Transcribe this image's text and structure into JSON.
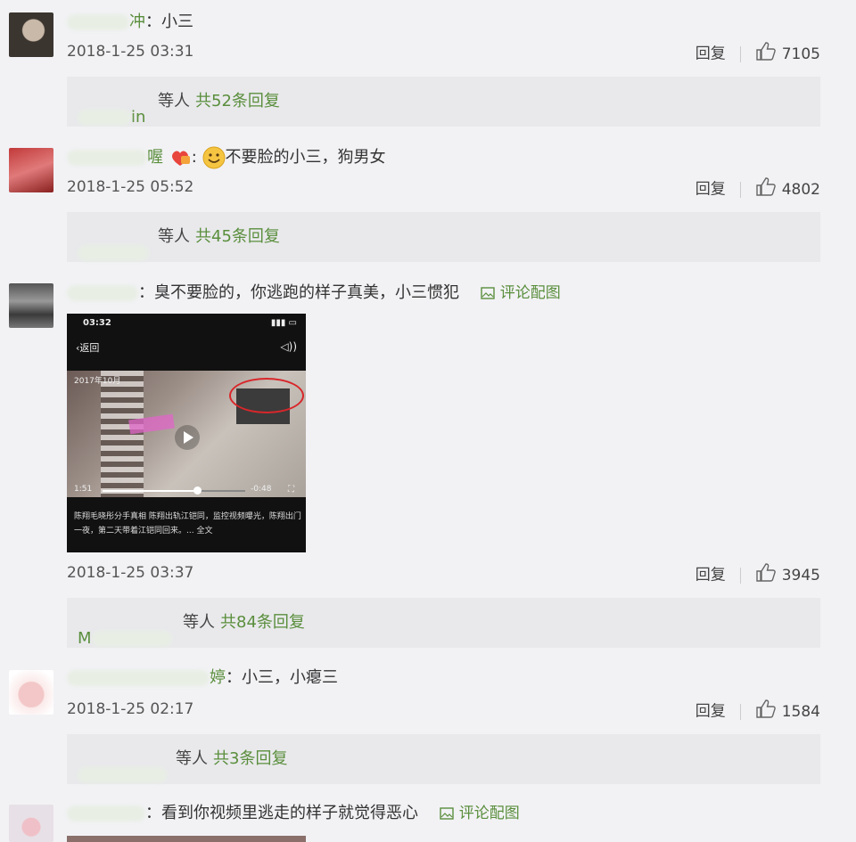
{
  "comments": [
    {
      "username_visible": "冲",
      "text": "小三",
      "time": "2018-1-25 03:31",
      "reply_label": "回复",
      "likes": "7105",
      "reply_summary": {
        "names_visible": "in",
        "suffix": "等人",
        "total": "共52条回复"
      }
    },
    {
      "username_visible": "喔",
      "text": "不要脸的小三，狗男女",
      "time": "2018-1-25 05:52",
      "reply_label": "回复",
      "likes": "4802",
      "reply_summary": {
        "names_visible": "",
        "suffix": "等人",
        "total": "共45条回复"
      }
    },
    {
      "username_visible": "",
      "text": "臭不要脸的，你逃跑的样子真美，小三惯犯",
      "pic_link": "评论配图",
      "video": {
        "status_time": "03:32",
        "back_label": "返回",
        "watermark": "2017年10月",
        "current": "1:51",
        "remaining": "-0:48",
        "caption": "陈翔毛晓彤分手真相 陈翔出轨江铠同，监控视频曝光，陈翔出门一夜，第二天带着江铠同回来。... 全文"
      },
      "time": "2018-1-25 03:37",
      "reply_label": "回复",
      "likes": "3945",
      "reply_summary": {
        "names_visible": "M",
        "suffix": "等人",
        "total": "共84条回复"
      }
    },
    {
      "username_visible": "婷",
      "text": "小三，小瘪三",
      "time": "2018-1-25 02:17",
      "reply_label": "回复",
      "likes": "1584",
      "reply_summary": {
        "names_visible": "",
        "suffix": "等人",
        "total": "共3条回复"
      }
    },
    {
      "username_visible": "",
      "text": "看到你视频里逃走的样子就觉得恶心",
      "pic_link": "评论配图"
    }
  ],
  "colors": {
    "username": "#5a8e3c",
    "background": "#f2f2f5",
    "reply_box": "#e9e9ec"
  }
}
